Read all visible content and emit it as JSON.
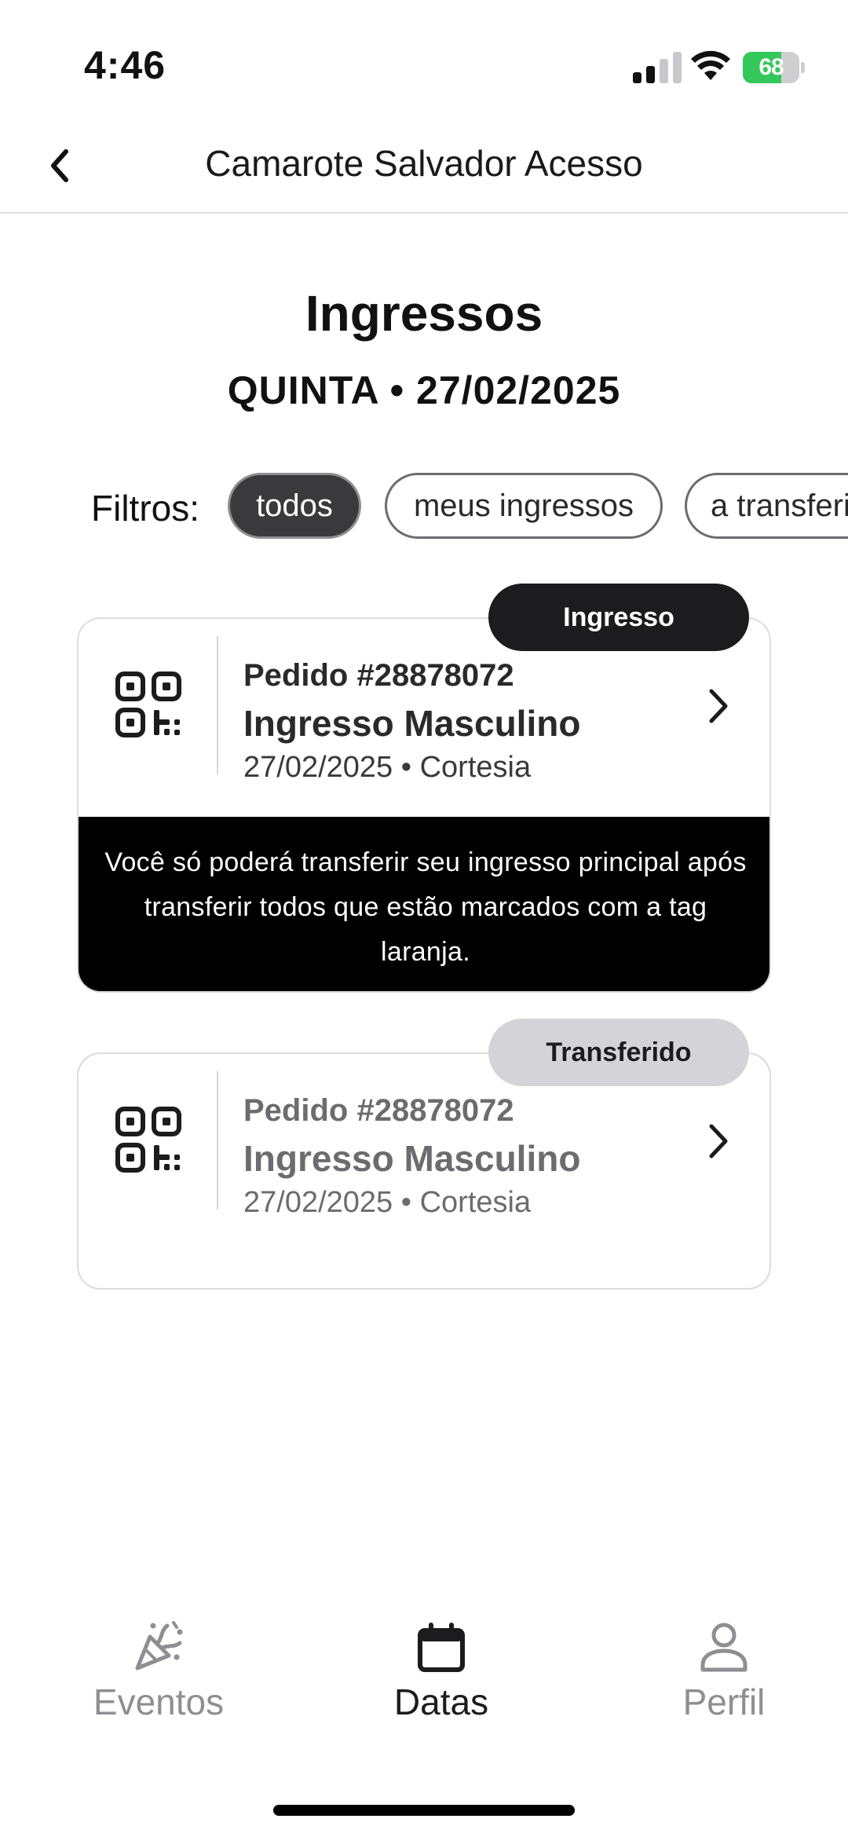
{
  "status_bar": {
    "time": "4:46",
    "battery_level": "68",
    "battery_percent": 68,
    "battery_color": "#34c759"
  },
  "nav": {
    "title": "Camarote Salvador Acesso",
    "back_icon": "chevron-left-icon"
  },
  "header": {
    "title": "Ingressos",
    "date": "QUINTA • 27/02/2025"
  },
  "filters": {
    "label": "Filtros:",
    "chips": [
      {
        "label": "todos",
        "active": true
      },
      {
        "label": "meus ingressos",
        "active": false
      },
      {
        "label": "a transferir",
        "active": false
      }
    ]
  },
  "tickets": [
    {
      "tag": "Ingresso",
      "order": "Pedido #28878072",
      "name": "Ingresso Masculino",
      "meta": "27/02/2025 • Cortesia",
      "notice": "Você só poderá transferir seu ingresso principal após transferir todos que estão marcados com a tag laranja.",
      "icon": "qr-code-icon"
    },
    {
      "tag": "Transferido",
      "order": "Pedido #28878072",
      "name": "Ingresso Masculino",
      "meta": "27/02/2025 • Cortesia",
      "icon": "qr-code-icon"
    }
  ],
  "tab_bar": {
    "tabs": [
      {
        "label": "Eventos",
        "icon": "party-popper-icon",
        "active": false
      },
      {
        "label": "Datas",
        "icon": "calendar-icon",
        "active": true
      },
      {
        "label": "Perfil",
        "icon": "person-icon",
        "active": false
      }
    ]
  }
}
